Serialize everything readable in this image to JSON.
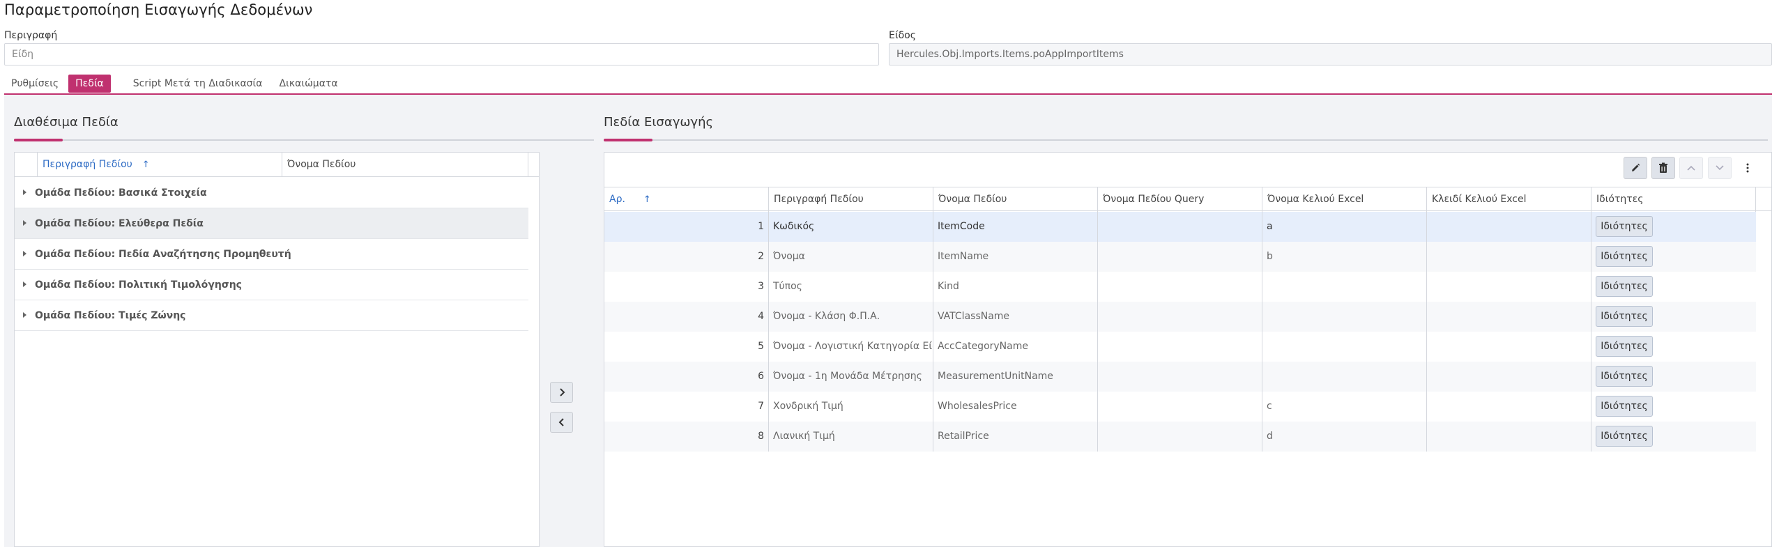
{
  "page": {
    "title": "Παραμετροποίηση Εισαγωγής Δεδομένων"
  },
  "form": {
    "description_label": "Περιγραφή",
    "description_value": "Είδη",
    "type_label": "Είδος",
    "type_value": "Hercules.Obj.Imports.Items.poAppImportItems"
  },
  "tabs": [
    {
      "label": "Ρυθμίσεις",
      "active": false
    },
    {
      "label": "Πεδία",
      "active": true
    },
    {
      "label": "Script Μετά τη Διαδικασία",
      "active": false
    },
    {
      "label": "Δικαιώματα",
      "active": false
    }
  ],
  "available": {
    "title": "Διαθέσιμα Πεδία",
    "columns": [
      "Περιγραφή Πεδίου",
      "Όνομα Πεδίου"
    ],
    "sort_icon": "arrow-up-icon",
    "groups": [
      "Ομάδα Πεδίου: Βασικά Στοιχεία",
      "Ομάδα Πεδίου: Ελεύθερα Πεδία",
      "Ομάδα Πεδίου: Πεδία Αναζήτησης Προμηθευτή",
      "Ομάδα Πεδίου: Πολιτική Τιμολόγησης",
      "Ομάδα Πεδίου: Τιμές Ζώνης"
    ]
  },
  "transfer": {
    "add_icon": "chevron-right-icon",
    "remove_icon": "chevron-left-icon"
  },
  "imported": {
    "title": "Πεδία Εισαγωγής",
    "toolbar": [
      "edit-icon",
      "delete-icon",
      "move-up-icon",
      "move-down-icon",
      "more-vertical-icon"
    ],
    "columns": [
      "Αρ.",
      "Περιγραφή Πεδίου",
      "Όνομα Πεδίου",
      "Όνομα Πεδίου Query",
      "Όνομα Κελιού Excel",
      "Κλειδί Κελιού Excel",
      "Ιδιότητες"
    ],
    "button_label": "Ιδιότητες",
    "rows": [
      {
        "no": "1",
        "desc": "Κωδικός",
        "name": "ItemCode",
        "query": "",
        "excel": "a",
        "key": ""
      },
      {
        "no": "2",
        "desc": "Όνομα",
        "name": "ItemName",
        "query": "",
        "excel": "b",
        "key": ""
      },
      {
        "no": "3",
        "desc": "Τύπος",
        "name": "Kind",
        "query": "",
        "excel": "",
        "key": ""
      },
      {
        "no": "4",
        "desc": "Όνομα - Κλάση Φ.Π.Α.",
        "name": "VATClassName",
        "query": "",
        "excel": "",
        "key": ""
      },
      {
        "no": "5",
        "desc": "Όνομα - Λογιστική Κατηγορία Είδο",
        "name": "AccCategoryName",
        "query": "",
        "excel": "",
        "key": ""
      },
      {
        "no": "6",
        "desc": "Όνομα - 1η Μονάδα Μέτρησης",
        "name": "MeasurementUnitName",
        "query": "",
        "excel": "",
        "key": ""
      },
      {
        "no": "7",
        "desc": "Χονδρική Τιμή",
        "name": "WholesalesPrice",
        "query": "",
        "excel": "c",
        "key": ""
      },
      {
        "no": "8",
        "desc": "Λιανική Τιμή",
        "name": "RetailPrice",
        "query": "",
        "excel": "d",
        "key": ""
      }
    ]
  },
  "colors": {
    "accent": "#c0316f",
    "link": "#2d6bc4",
    "selected_row": "#e6eefb"
  }
}
